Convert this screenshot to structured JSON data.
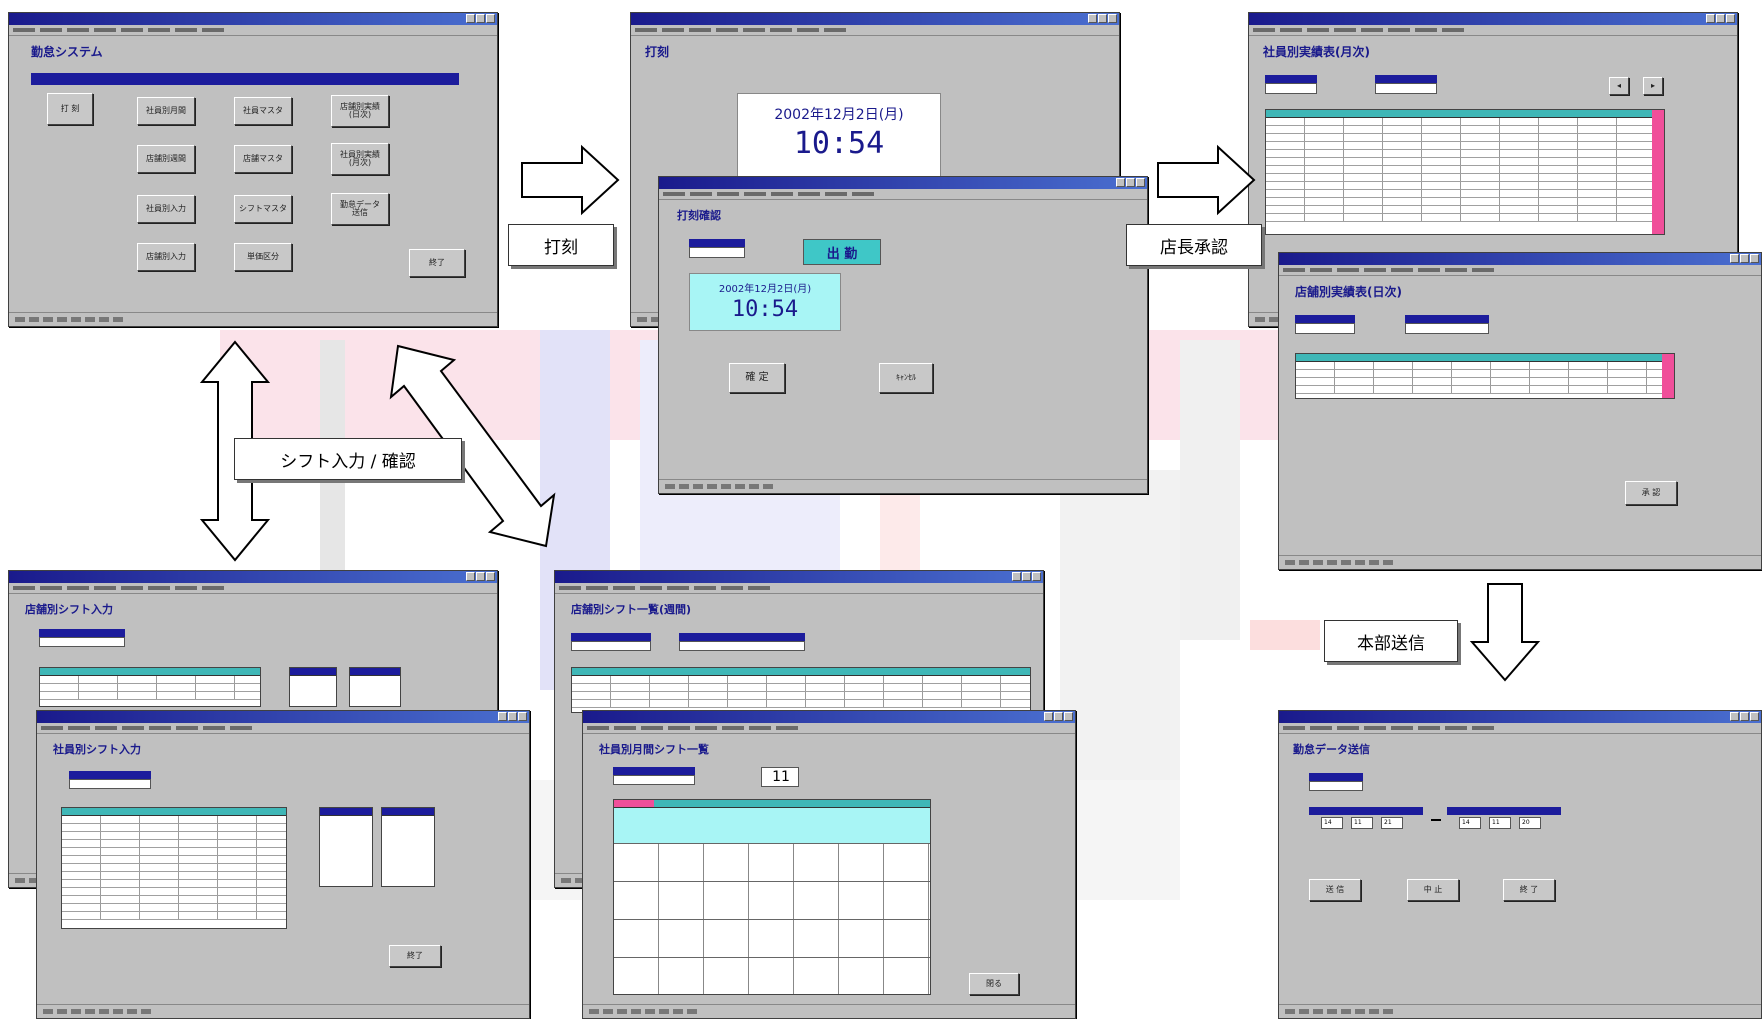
{
  "labels": {
    "punch": "打刻",
    "manager_approval": "店長承認",
    "shift_input_confirm": "シフト入力 / 確認",
    "hq_send": "本部送信"
  },
  "main_menu": {
    "title": "勤怠システム",
    "buttons": [
      "打 刻",
      "社員別月間",
      "社員マスタ",
      "店舗別実績\n(日次)",
      "店舗別週間",
      "店舗マスタ",
      "社員別実績\n(月次)",
      "社員別入力",
      "シフトマスタ",
      "勤怠データ\n送信",
      "店舗別入力",
      "単価区分",
      "終了"
    ]
  },
  "punch_window": {
    "title": "打刻",
    "date": "2002年12月2日(月)",
    "time": "10:54"
  },
  "punch_confirm": {
    "title": "打刻確認",
    "status": "出 勤",
    "date": "2002年12月2日(月)",
    "time": "10:54",
    "ok": "確 定",
    "cancel": "ｷｬﾝｾﾙ"
  },
  "monthly_window": {
    "title": "社員別実績表(月次)"
  },
  "daily_window": {
    "title": "店舗別実績表(日次)",
    "button": "承 認"
  },
  "shift_store_input": {
    "title": "店舗別シフト入力"
  },
  "shift_employee_input": {
    "title": "社員別シフト入力",
    "button": "終了"
  },
  "shift_weekly": {
    "title": "店舗別シフト一覧(週間)"
  },
  "shift_monthly": {
    "title": "社員別月間シフト一覧",
    "month": "11",
    "button": "閉る"
  },
  "send_window": {
    "title": "勤怠データ送信",
    "from": [
      "14",
      "11",
      "21"
    ],
    "to": [
      "14",
      "11",
      "20"
    ],
    "buttons": [
      "送 信",
      "中 止",
      "終 了"
    ]
  },
  "colors": {
    "navy": "#1a1a8c",
    "teal": "#3fb7b7",
    "pink": "#f04f9a",
    "window_gray": "#c0c0c0",
    "status_cyan": "#3fc7c7",
    "clock_bg": "#a8f5f5"
  }
}
